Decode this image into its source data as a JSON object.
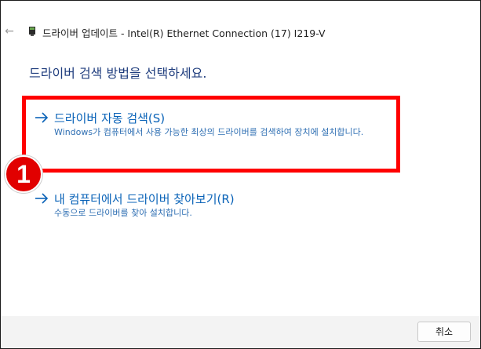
{
  "window": {
    "title": "드라이버 업데이트 - Intel(R) Ethernet Connection (17) I219-V",
    "close_glyph": "✕",
    "back_glyph": "←"
  },
  "main": {
    "heading": "드라이버 검색 방법을 선택하세요.",
    "options": [
      {
        "title": "드라이버 자동 검색(S)",
        "description": "Windows가 컴퓨터에서 사용 가능한 최상의 드라이버를 검색하여 장치에 설치합니다."
      },
      {
        "title": "내 컴퓨터에서 드라이버 찾아보기(R)",
        "description": "수동으로 드라이버를 찾아 설치합니다."
      }
    ]
  },
  "annotation": {
    "badge_number": "1",
    "highlight_color": "#ff0000"
  },
  "footer": {
    "cancel_label": "취소"
  },
  "colors": {
    "link": "#0a63b8",
    "heading": "#1e3c7d",
    "badge": "#e10000"
  }
}
